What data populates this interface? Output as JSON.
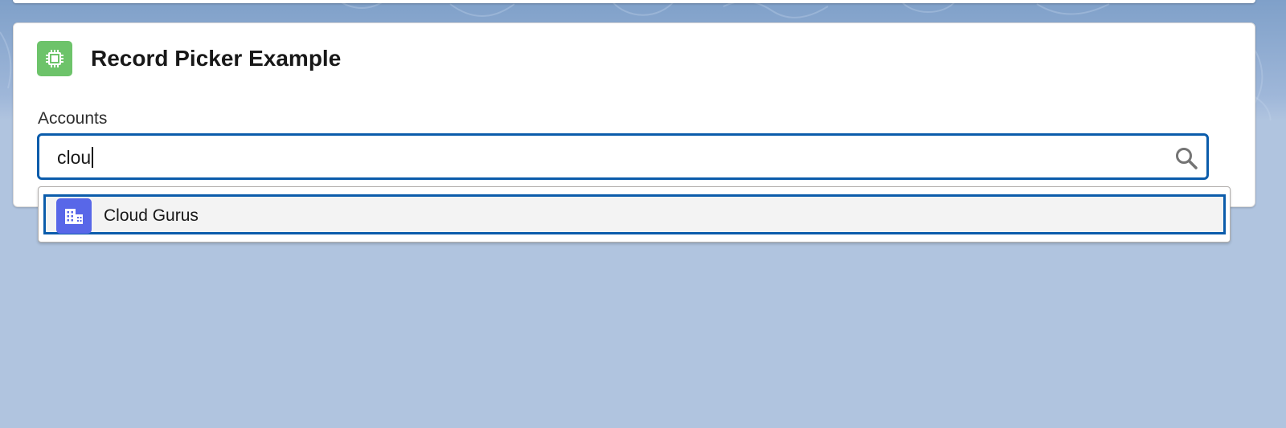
{
  "card": {
    "title": "Record Picker Example",
    "icon": "component-chip-icon",
    "icon_color": "#6dc36a"
  },
  "picker": {
    "label": "Accounts",
    "value": "clou",
    "search_icon": "search-icon",
    "focus_color": "#0b5cab"
  },
  "results": [
    {
      "label": "Cloud Gurus",
      "icon": "account-building-icon",
      "icon_color": "#5867e8"
    }
  ]
}
